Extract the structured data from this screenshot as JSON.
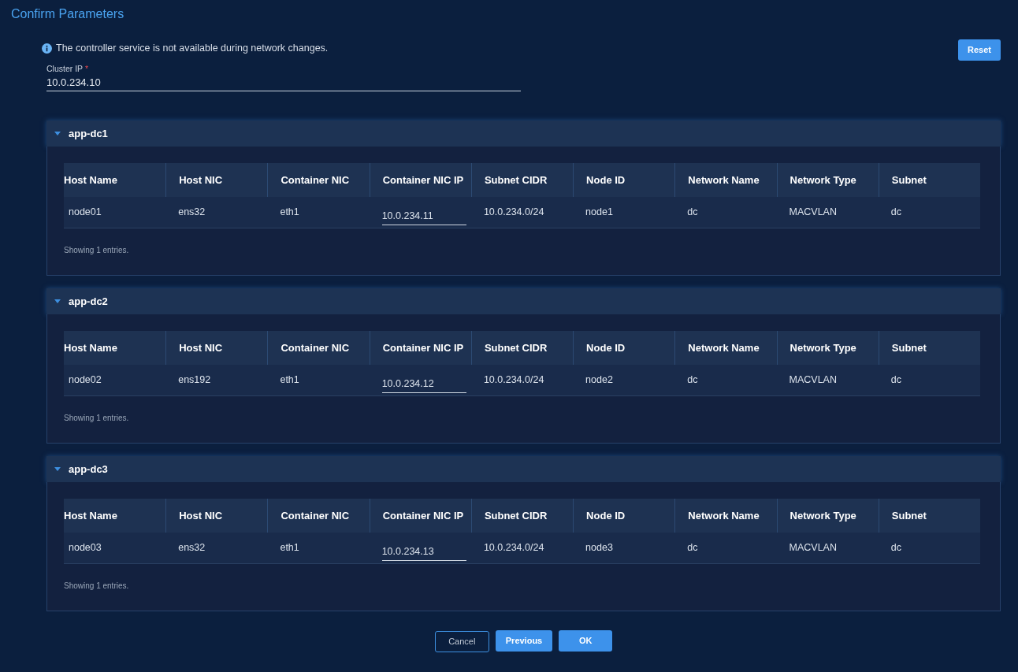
{
  "title": "Confirm Parameters",
  "notice": "The controller service is not available during network changes.",
  "reset_button": "Reset",
  "cluster_ip": {
    "label": "Cluster IP",
    "required_mark": "*",
    "value": "10.0.234.10"
  },
  "sections": [
    {
      "name": "app-dc1",
      "expanded": true,
      "columns": [
        {
          "label": "Host Name",
          "kind": "text"
        },
        {
          "label": "Host NIC",
          "kind": "text"
        },
        {
          "label": "Container NIC",
          "kind": "text"
        },
        {
          "label": "Container NIC IP",
          "kind": "input"
        },
        {
          "label": "Subnet CIDR",
          "kind": "text"
        },
        {
          "label": "Node ID",
          "kind": "text"
        },
        {
          "label": "Network Name",
          "kind": "text"
        },
        {
          "label": "Network Type",
          "kind": "text"
        },
        {
          "label": "Subnet",
          "kind": "text"
        }
      ],
      "rows": [
        [
          "node01",
          "ens32",
          "eth1",
          "10.0.234.11",
          "10.0.234.0/24",
          "node1",
          "dc",
          "MACVLAN",
          "dc"
        ]
      ],
      "footer": "Showing 1 entries."
    },
    {
      "name": "app-dc2",
      "expanded": true,
      "columns": [
        {
          "label": "Host Name",
          "kind": "text"
        },
        {
          "label": "Host NIC",
          "kind": "text"
        },
        {
          "label": "Container NIC",
          "kind": "text"
        },
        {
          "label": "Container NIC IP",
          "kind": "input"
        },
        {
          "label": "Subnet CIDR",
          "kind": "text"
        },
        {
          "label": "Node ID",
          "kind": "text"
        },
        {
          "label": "Network Name",
          "kind": "text"
        },
        {
          "label": "Network Type",
          "kind": "text"
        },
        {
          "label": "Subnet",
          "kind": "text"
        }
      ],
      "rows": [
        [
          "node02",
          "ens192",
          "eth1",
          "10.0.234.12",
          "10.0.234.0/24",
          "node2",
          "dc",
          "MACVLAN",
          "dc"
        ]
      ],
      "footer": "Showing 1 entries."
    },
    {
      "name": "app-dc3",
      "expanded": true,
      "columns": [
        {
          "label": "Host Name",
          "kind": "text"
        },
        {
          "label": "Host NIC",
          "kind": "text"
        },
        {
          "label": "Container NIC",
          "kind": "text"
        },
        {
          "label": "Container NIC IP",
          "kind": "input"
        },
        {
          "label": "Subnet CIDR",
          "kind": "text"
        },
        {
          "label": "Node ID",
          "kind": "text"
        },
        {
          "label": "Network Name",
          "kind": "text"
        },
        {
          "label": "Network Type",
          "kind": "text"
        },
        {
          "label": "Subnet",
          "kind": "text"
        }
      ],
      "rows": [
        [
          "node03",
          "ens32",
          "eth1",
          "10.0.234.13",
          "10.0.234.0/24",
          "node3",
          "dc",
          "MACVLAN",
          "dc"
        ]
      ],
      "footer": "Showing 1 entries."
    }
  ],
  "buttons": [
    {
      "label": "Cancel",
      "kind": "secondary"
    },
    {
      "label": "Previous",
      "kind": "primary"
    },
    {
      "label": "OK",
      "kind": "primary"
    }
  ]
}
